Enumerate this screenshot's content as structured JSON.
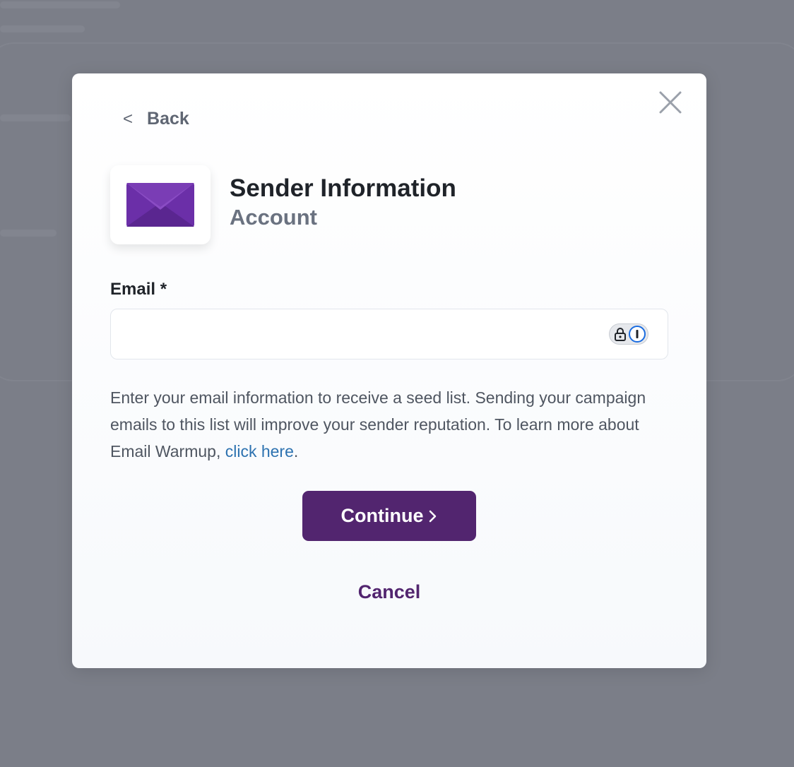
{
  "modal": {
    "back_label": "Back",
    "title": "Sender Information",
    "subtitle": "Account",
    "email_label": "Email *",
    "email_value": "",
    "help_text_before": "Enter your email information to receive a seed list. Sending your campaign emails to this list will improve your sender reputation. To learn more about Email Warmup, ",
    "help_link": "click here",
    "help_text_after": ".",
    "continue_label": "Continue",
    "cancel_label": "Cancel"
  },
  "icons": {
    "close": "close-icon",
    "back": "chevron-left-icon",
    "envelope": "envelope-icon",
    "password_manager": "password-manager-icon",
    "continue_arrow": "chevron-right-icon"
  },
  "colors": {
    "brand_purple": "#52256f",
    "envelope_purple": "#6b2fa8",
    "link_blue": "#2d72b0",
    "backdrop": "#7b7e88"
  }
}
